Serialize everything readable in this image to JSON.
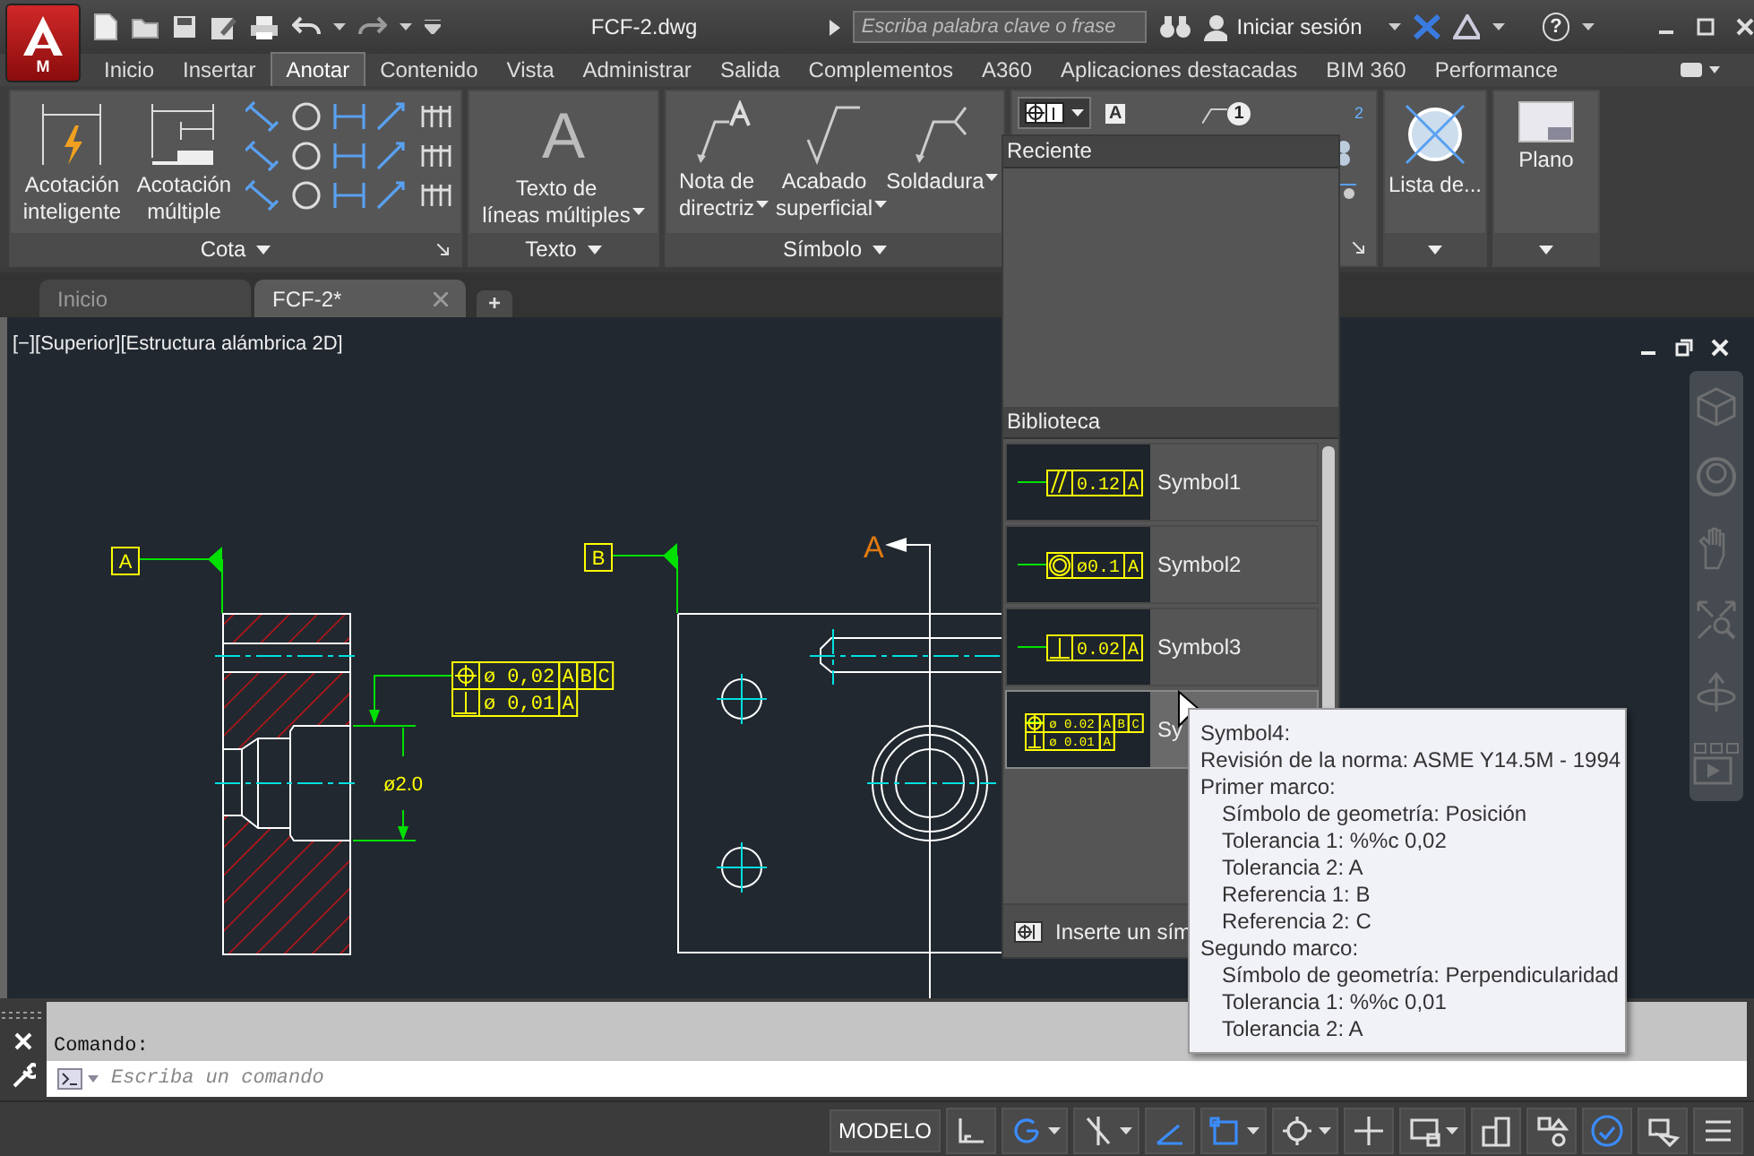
{
  "title_bar": {
    "app_badge": "M",
    "file_name": "FCF-2.dwg",
    "search": {
      "placeholder": "Escriba palabra clave o frase"
    },
    "sign_in": "Iniciar sesión",
    "help": "?"
  },
  "ribbon_tabs": [
    {
      "label": "Inicio",
      "selected": false
    },
    {
      "label": "Insertar",
      "selected": false
    },
    {
      "label": "Anotar",
      "selected": true
    },
    {
      "label": "Contenido",
      "selected": false
    },
    {
      "label": "Vista",
      "selected": false
    },
    {
      "label": "Administrar",
      "selected": false
    },
    {
      "label": "Salida",
      "selected": false
    },
    {
      "label": "Complementos",
      "selected": false
    },
    {
      "label": "A360",
      "selected": false
    },
    {
      "label": "Aplicaciones destacadas",
      "selected": false
    },
    {
      "label": "BIM 360",
      "selected": false
    },
    {
      "label": "Performance",
      "selected": false
    }
  ],
  "ribbon_panels": [
    {
      "kind": "cota",
      "title": "Cota",
      "tools": [
        {
          "label": "Acotación\ninteligente"
        },
        {
          "label": "Acotación\nmúltiple"
        }
      ]
    },
    {
      "kind": "texto",
      "title": "Texto",
      "glyph": "A",
      "tools": [
        {
          "label": "Texto de\nlíneas múltiples"
        }
      ]
    },
    {
      "kind": "simbolo",
      "title": "Símbolo",
      "tools": [
        {
          "label": "Nota de\ndirectriz"
        },
        {
          "label": "Acabado\nsuperficial"
        },
        {
          "label": "Soldadura"
        }
      ]
    },
    {
      "kind": "tolerancia",
      "glyph": "A",
      "balloon": "1",
      "renumber": "2"
    },
    {
      "kind": "lista",
      "tools": [
        {
          "label": "Lista de..."
        }
      ]
    },
    {
      "kind": "plano",
      "tools": [
        {
          "label": "Plano"
        }
      ]
    }
  ],
  "file_tabs": [
    {
      "label": "Inicio",
      "selected": false
    },
    {
      "label": "FCF-2*",
      "selected": true
    }
  ],
  "new_tab": "+",
  "viewport": {
    "label": "[−][Superior][Estructura alámbrica 2D]",
    "datums": [
      {
        "label": "A"
      },
      {
        "label": "B"
      }
    ],
    "section_letter": "A",
    "dimension": "ø2.0",
    "fcf": [
      {
        "kind": "position",
        "cells": [
          "ø 0,02",
          "A",
          "B",
          "C"
        ]
      },
      {
        "kind": "perpendicularity",
        "cells": [
          "ø 0,01",
          "A"
        ]
      }
    ]
  },
  "fcf_menu": {
    "recent_header": "Reciente",
    "library_header": "Biblioteca",
    "footer": "Inserte un sím",
    "symbols": [
      {
        "label": "Symbol1",
        "selected": false,
        "rows": [
          {
            "kind": "parallelism",
            "cells": [
              "0.12",
              "A"
            ]
          }
        ]
      },
      {
        "label": "Symbol2",
        "selected": false,
        "rows": [
          {
            "kind": "concentricity",
            "cells": [
              "ø0.1",
              "A"
            ]
          }
        ]
      },
      {
        "label": "Symbol3",
        "selected": false,
        "rows": [
          {
            "kind": "perpendicularity",
            "cells": [
              "0.02",
              "A"
            ]
          }
        ]
      },
      {
        "label": "Sy",
        "selected": true,
        "rows": [
          {
            "kind": "position",
            "cells": [
              "ø 0.02",
              "A",
              "B",
              "C"
            ]
          },
          {
            "kind": "perpendicularity",
            "cells": [
              "ø 0.01",
              "A"
            ]
          }
        ]
      }
    ]
  },
  "tooltip": {
    "items": [
      {
        "text": "Symbol4:"
      },
      {
        "text": "Revisión de la norma: ASME Y14.5M - 1994"
      },
      {
        "text": "Primer marco:",
        "children": [
          {
            "text": "Símbolo de geometría: Posición"
          },
          {
            "text": "Tolerancia 1: %%c 0,02"
          },
          {
            "text": "Tolerancia 2: A"
          },
          {
            "text": "Referencia 1: B"
          },
          {
            "text": "Referencia 2: C"
          }
        ]
      },
      {
        "text": "Segundo marco:",
        "children": [
          {
            "text": "Símbolo de geometría: Perpendicularidad"
          },
          {
            "text": "Tolerancia 1: %%c 0,01"
          },
          {
            "text": "Tolerancia 2: A"
          }
        ]
      }
    ]
  },
  "command": {
    "history": "Comando:",
    "placeholder": "Escriba un comando"
  },
  "status_bar": {
    "model": "MODELO",
    "tools": [
      {
        "kind": "grid",
        "on": false,
        "dropdown": false
      },
      {
        "kind": "polar",
        "on": true,
        "dropdown": true
      },
      {
        "kind": "tracking",
        "on": false,
        "dropdown": true
      },
      {
        "kind": "isodraft",
        "on": true,
        "dropdown": false
      },
      {
        "kind": "snap",
        "on": true,
        "dropdown": true
      },
      {
        "kind": "gear",
        "on": false,
        "dropdown": true
      },
      {
        "kind": "plus",
        "on": false,
        "dropdown": false
      },
      {
        "kind": "workspace",
        "on": false,
        "dropdown": true
      },
      {
        "kind": "isolate",
        "on": false,
        "dropdown": false
      },
      {
        "kind": "shapes",
        "on": false,
        "dropdown": false
      },
      {
        "kind": "clean",
        "on": true,
        "dropdown": false
      },
      {
        "kind": "hardware",
        "on": false,
        "dropdown": false
      },
      {
        "kind": "menu",
        "on": false,
        "dropdown": false
      }
    ]
  }
}
